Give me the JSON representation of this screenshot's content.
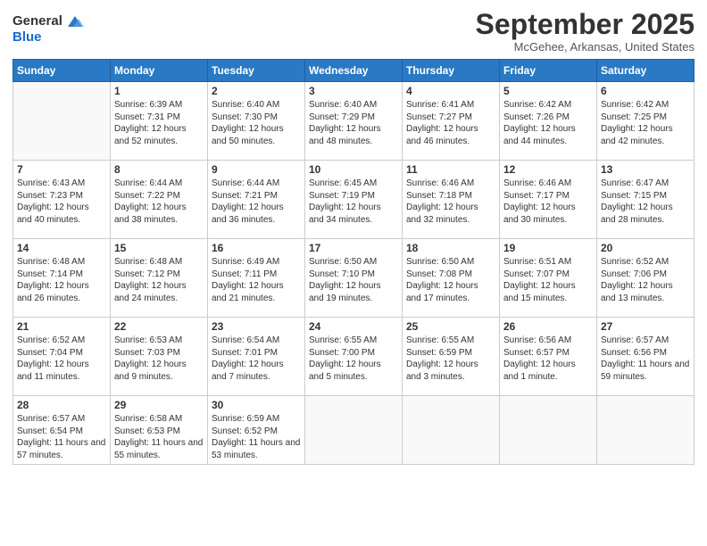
{
  "logo": {
    "general": "General",
    "blue": "Blue"
  },
  "header": {
    "month": "September 2025",
    "location": "McGehee, Arkansas, United States"
  },
  "days_of_week": [
    "Sunday",
    "Monday",
    "Tuesday",
    "Wednesday",
    "Thursday",
    "Friday",
    "Saturday"
  ],
  "weeks": [
    [
      {
        "day": "",
        "empty": true
      },
      {
        "day": "1",
        "sunrise": "Sunrise: 6:39 AM",
        "sunset": "Sunset: 7:31 PM",
        "daylight": "Daylight: 12 hours and 52 minutes."
      },
      {
        "day": "2",
        "sunrise": "Sunrise: 6:40 AM",
        "sunset": "Sunset: 7:30 PM",
        "daylight": "Daylight: 12 hours and 50 minutes."
      },
      {
        "day": "3",
        "sunrise": "Sunrise: 6:40 AM",
        "sunset": "Sunset: 7:29 PM",
        "daylight": "Daylight: 12 hours and 48 minutes."
      },
      {
        "day": "4",
        "sunrise": "Sunrise: 6:41 AM",
        "sunset": "Sunset: 7:27 PM",
        "daylight": "Daylight: 12 hours and 46 minutes."
      },
      {
        "day": "5",
        "sunrise": "Sunrise: 6:42 AM",
        "sunset": "Sunset: 7:26 PM",
        "daylight": "Daylight: 12 hours and 44 minutes."
      },
      {
        "day": "6",
        "sunrise": "Sunrise: 6:42 AM",
        "sunset": "Sunset: 7:25 PM",
        "daylight": "Daylight: 12 hours and 42 minutes."
      }
    ],
    [
      {
        "day": "7",
        "sunrise": "Sunrise: 6:43 AM",
        "sunset": "Sunset: 7:23 PM",
        "daylight": "Daylight: 12 hours and 40 minutes."
      },
      {
        "day": "8",
        "sunrise": "Sunrise: 6:44 AM",
        "sunset": "Sunset: 7:22 PM",
        "daylight": "Daylight: 12 hours and 38 minutes."
      },
      {
        "day": "9",
        "sunrise": "Sunrise: 6:44 AM",
        "sunset": "Sunset: 7:21 PM",
        "daylight": "Daylight: 12 hours and 36 minutes."
      },
      {
        "day": "10",
        "sunrise": "Sunrise: 6:45 AM",
        "sunset": "Sunset: 7:19 PM",
        "daylight": "Daylight: 12 hours and 34 minutes."
      },
      {
        "day": "11",
        "sunrise": "Sunrise: 6:46 AM",
        "sunset": "Sunset: 7:18 PM",
        "daylight": "Daylight: 12 hours and 32 minutes."
      },
      {
        "day": "12",
        "sunrise": "Sunrise: 6:46 AM",
        "sunset": "Sunset: 7:17 PM",
        "daylight": "Daylight: 12 hours and 30 minutes."
      },
      {
        "day": "13",
        "sunrise": "Sunrise: 6:47 AM",
        "sunset": "Sunset: 7:15 PM",
        "daylight": "Daylight: 12 hours and 28 minutes."
      }
    ],
    [
      {
        "day": "14",
        "sunrise": "Sunrise: 6:48 AM",
        "sunset": "Sunset: 7:14 PM",
        "daylight": "Daylight: 12 hours and 26 minutes."
      },
      {
        "day": "15",
        "sunrise": "Sunrise: 6:48 AM",
        "sunset": "Sunset: 7:12 PM",
        "daylight": "Daylight: 12 hours and 24 minutes."
      },
      {
        "day": "16",
        "sunrise": "Sunrise: 6:49 AM",
        "sunset": "Sunset: 7:11 PM",
        "daylight": "Daylight: 12 hours and 21 minutes."
      },
      {
        "day": "17",
        "sunrise": "Sunrise: 6:50 AM",
        "sunset": "Sunset: 7:10 PM",
        "daylight": "Daylight: 12 hours and 19 minutes."
      },
      {
        "day": "18",
        "sunrise": "Sunrise: 6:50 AM",
        "sunset": "Sunset: 7:08 PM",
        "daylight": "Daylight: 12 hours and 17 minutes."
      },
      {
        "day": "19",
        "sunrise": "Sunrise: 6:51 AM",
        "sunset": "Sunset: 7:07 PM",
        "daylight": "Daylight: 12 hours and 15 minutes."
      },
      {
        "day": "20",
        "sunrise": "Sunrise: 6:52 AM",
        "sunset": "Sunset: 7:06 PM",
        "daylight": "Daylight: 12 hours and 13 minutes."
      }
    ],
    [
      {
        "day": "21",
        "sunrise": "Sunrise: 6:52 AM",
        "sunset": "Sunset: 7:04 PM",
        "daylight": "Daylight: 12 hours and 11 minutes."
      },
      {
        "day": "22",
        "sunrise": "Sunrise: 6:53 AM",
        "sunset": "Sunset: 7:03 PM",
        "daylight": "Daylight: 12 hours and 9 minutes."
      },
      {
        "day": "23",
        "sunrise": "Sunrise: 6:54 AM",
        "sunset": "Sunset: 7:01 PM",
        "daylight": "Daylight: 12 hours and 7 minutes."
      },
      {
        "day": "24",
        "sunrise": "Sunrise: 6:55 AM",
        "sunset": "Sunset: 7:00 PM",
        "daylight": "Daylight: 12 hours and 5 minutes."
      },
      {
        "day": "25",
        "sunrise": "Sunrise: 6:55 AM",
        "sunset": "Sunset: 6:59 PM",
        "daylight": "Daylight: 12 hours and 3 minutes."
      },
      {
        "day": "26",
        "sunrise": "Sunrise: 6:56 AM",
        "sunset": "Sunset: 6:57 PM",
        "daylight": "Daylight: 12 hours and 1 minute."
      },
      {
        "day": "27",
        "sunrise": "Sunrise: 6:57 AM",
        "sunset": "Sunset: 6:56 PM",
        "daylight": "Daylight: 11 hours and 59 minutes."
      }
    ],
    [
      {
        "day": "28",
        "sunrise": "Sunrise: 6:57 AM",
        "sunset": "Sunset: 6:54 PM",
        "daylight": "Daylight: 11 hours and 57 minutes."
      },
      {
        "day": "29",
        "sunrise": "Sunrise: 6:58 AM",
        "sunset": "Sunset: 6:53 PM",
        "daylight": "Daylight: 11 hours and 55 minutes."
      },
      {
        "day": "30",
        "sunrise": "Sunrise: 6:59 AM",
        "sunset": "Sunset: 6:52 PM",
        "daylight": "Daylight: 11 hours and 53 minutes."
      },
      {
        "day": "",
        "empty": true
      },
      {
        "day": "",
        "empty": true
      },
      {
        "day": "",
        "empty": true
      },
      {
        "day": "",
        "empty": true
      }
    ]
  ]
}
